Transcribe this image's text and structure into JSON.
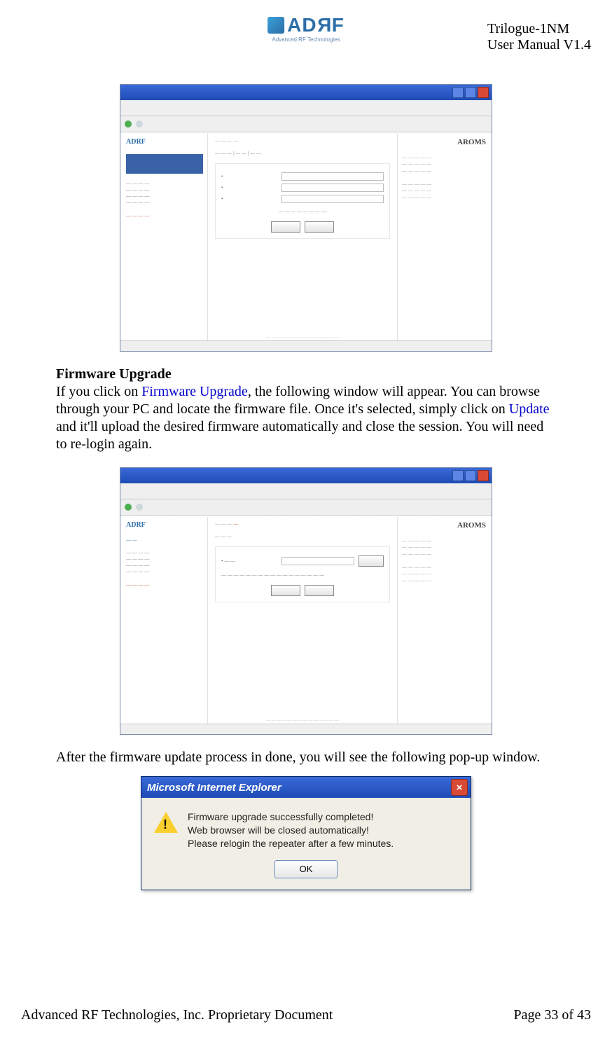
{
  "header": {
    "logo_sub": "Advanced RF Technologies",
    "doc_title": "Trilogue-1NM",
    "doc_version": "User Manual V1.4"
  },
  "section1": {
    "title": "Firmware Upgrade",
    "p_a": "If you click on ",
    "p_link1": "Firmware Upgrade",
    "p_b": ", the following window will appear.  You can browse through your PC and locate the firmware file.  Once it's selected, simply click on ",
    "p_link2": "Update",
    "p_c": " and it'll upload the desired firmware automatically and close the session.  You will need to re-login again."
  },
  "section2": {
    "p": "After the firmware update process in done, you will see the following pop-up window."
  },
  "dialog": {
    "title": "Microsoft Internet Explorer",
    "line1": "Firmware upgrade successfully completed!",
    "line2": "Web browser will be closed automatically!",
    "line3": "Please relogin the repeater after a few minutes.",
    "ok": "OK"
  },
  "shot_common": {
    "aroms": "AROMS",
    "adrf": "ADRF"
  },
  "footer": {
    "left": "Advanced RF Technologies, Inc. Proprietary Document",
    "right": "Page 33 of 43"
  }
}
